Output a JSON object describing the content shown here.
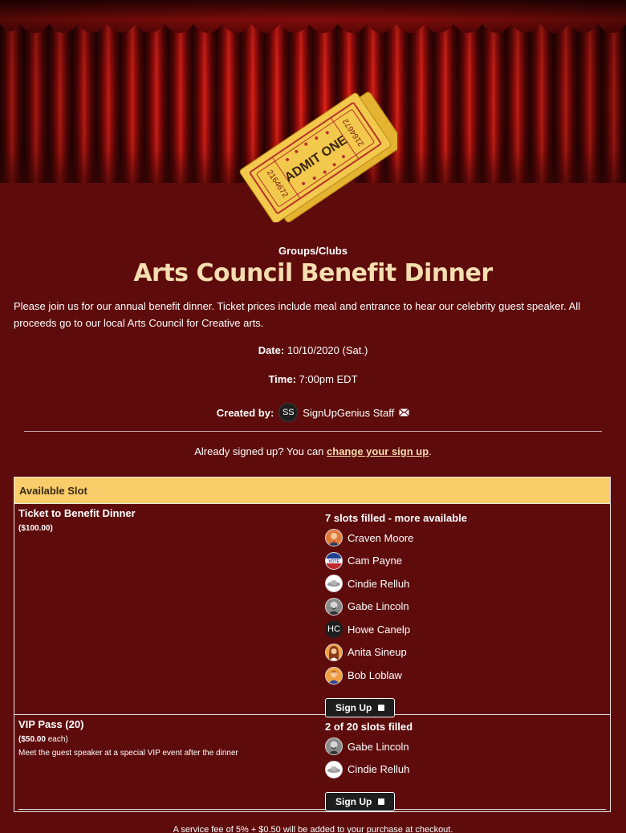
{
  "header": {
    "ticket_text": "ADMIT ONE",
    "ticket_serial": "2164672"
  },
  "event": {
    "category": "Groups/Clubs",
    "title": "Arts Council Benefit Dinner",
    "description": "Please join us for our annual benefit dinner.  Ticket prices include meal and entrance to hear our celebrity guest speaker.  All proceeds go to our local Arts Council for Creative arts.",
    "date_label": "Date:",
    "date_value": "10/10/2020 (Sat.)",
    "time_label": "Time:",
    "time_value": "7:00pm EDT",
    "created_by_label": "Created by:",
    "creator_initials": "SS",
    "creator_name": "SignUpGenius Staff"
  },
  "signed_up": {
    "prefix": "Already signed up? You can ",
    "link": "change your sign up",
    "suffix": "."
  },
  "slots": {
    "header": "Available Slot",
    "items": [
      {
        "name": "Ticket to Benefit Dinner",
        "price": "($100.00)",
        "status": "7 slots filled - more available",
        "participants": [
          {
            "name": "Craven Moore"
          },
          {
            "name": "Cam Payne"
          },
          {
            "name": "Cindie Relluh"
          },
          {
            "name": "Gabe Lincoln"
          },
          {
            "name": "Howe Canelp",
            "initials": "HC"
          },
          {
            "name": "Anita Sineup"
          },
          {
            "name": "Bob Loblaw"
          }
        ],
        "button": "Sign Up"
      },
      {
        "name": "VIP Pass (20)",
        "price_amount": "($50.00",
        "price_suffix": " each)",
        "note": "Meet the guest speaker at a special VIP event after the dinner",
        "status": "2 of 20 slots filled",
        "participants": [
          {
            "name": "Gabe Lincoln"
          },
          {
            "name": "Cindie Relluh"
          }
        ],
        "button": "Sign Up"
      }
    ]
  },
  "footer": {
    "fee_note": "A service fee of 5% + $0.50 will be added to your purchase at checkout."
  },
  "colors": {
    "background": "#5e0b0b",
    "title": "#f5deb0",
    "slot_header": "#f8cd6a",
    "curtain": "#b3110e",
    "ticket": "#f2c94c"
  }
}
